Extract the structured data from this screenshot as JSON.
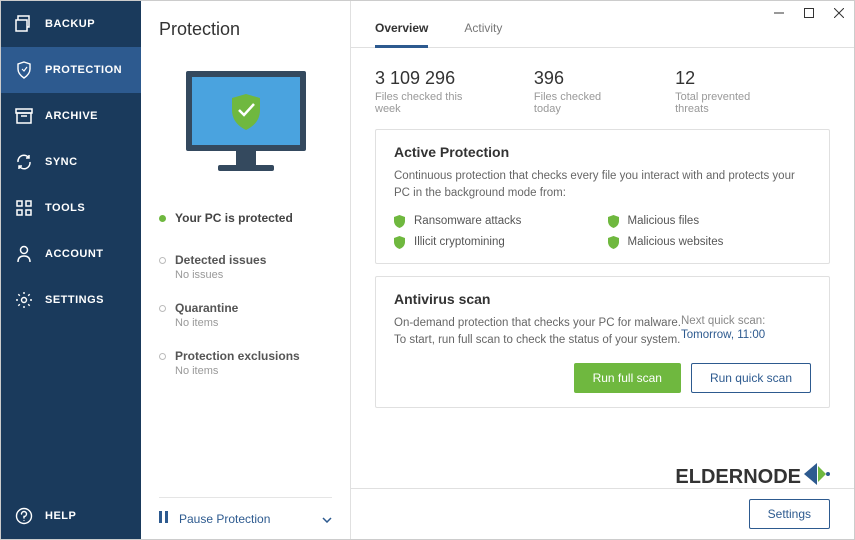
{
  "sidebar": {
    "items": [
      {
        "label": "BACKUP"
      },
      {
        "label": "PROTECTION"
      },
      {
        "label": "ARCHIVE"
      },
      {
        "label": "SYNC"
      },
      {
        "label": "TOOLS"
      },
      {
        "label": "ACCOUNT"
      },
      {
        "label": "SETTINGS"
      }
    ],
    "help": "HELP"
  },
  "middle": {
    "title": "Protection",
    "status_text": "Your PC is protected",
    "blocks": [
      {
        "title": "Detected issues",
        "sub": "No issues"
      },
      {
        "title": "Quarantine",
        "sub": "No items"
      },
      {
        "title": "Protection exclusions",
        "sub": "No items"
      }
    ],
    "pause_text": "Pause Protection"
  },
  "main": {
    "tabs": [
      {
        "label": "Overview"
      },
      {
        "label": "Activity"
      }
    ],
    "stats": [
      {
        "num": "3 109 296",
        "label": "Files checked this week"
      },
      {
        "num": "396",
        "label": "Files checked today"
      },
      {
        "num": "12",
        "label": "Total prevented threats"
      }
    ],
    "active_protection": {
      "heading": "Active Protection",
      "desc": "Continuous protection that checks every file you interact with and protects your PC in the background mode from:",
      "bullets": [
        "Ransomware attacks",
        "Malicious files",
        "Illicit cryptomining",
        "Malicious websites"
      ]
    },
    "antivirus": {
      "heading": "Antivirus scan",
      "desc": "On-demand protection that checks your PC for malware. To start, run full scan to check the status of your system.",
      "next_label": "Next quick scan:",
      "next_value": "Tomorrow, 11:00",
      "btn_full": "Run full scan",
      "btn_quick": "Run quick scan"
    },
    "settings_btn": "Settings",
    "brand": "ELDERNODE"
  }
}
